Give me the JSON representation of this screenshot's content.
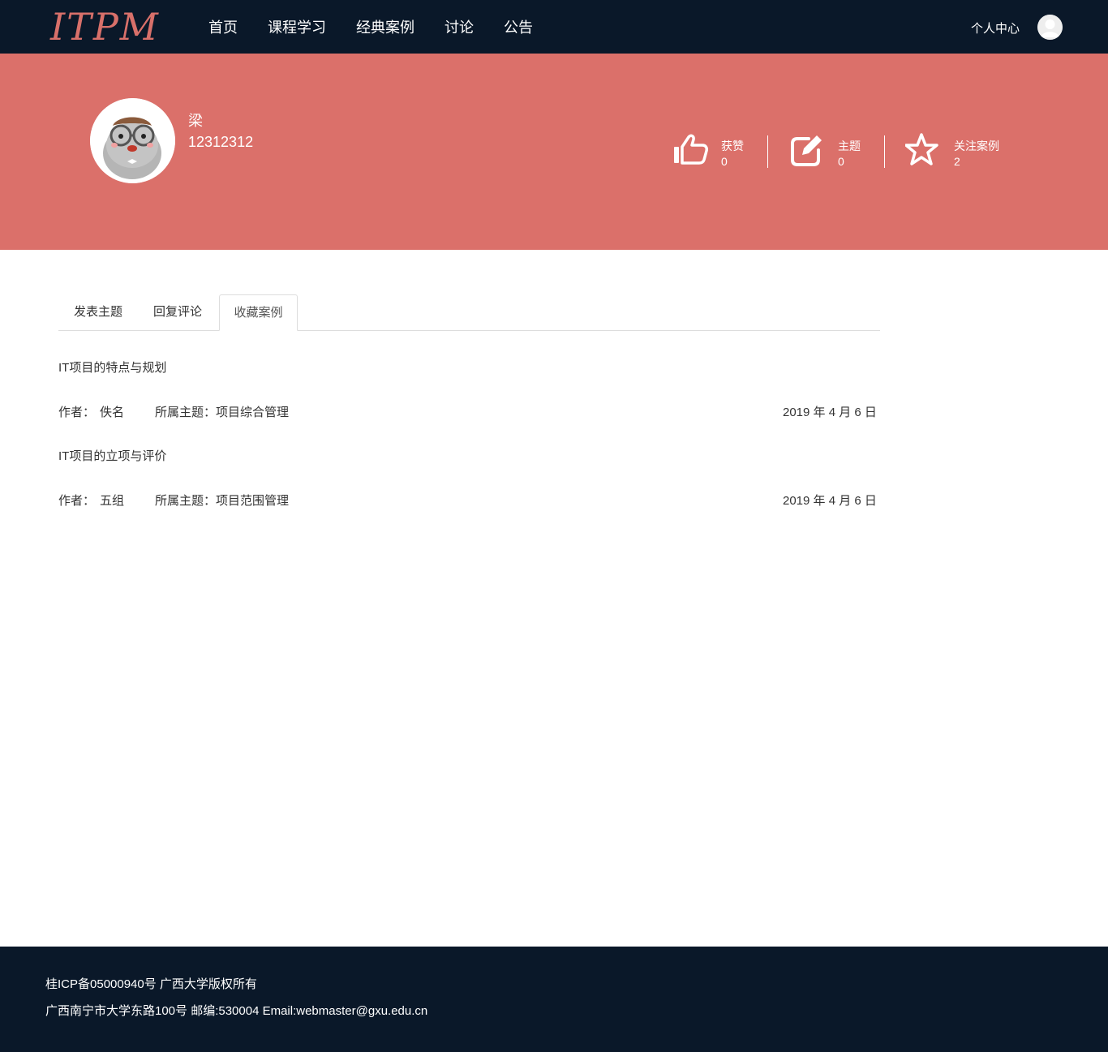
{
  "header": {
    "logo": "ITPM",
    "nav": [
      "首页",
      "课程学习",
      "经典案例",
      "讨论",
      "公告"
    ],
    "user_center": "个人中心"
  },
  "profile": {
    "name": "梁",
    "id": "12312312",
    "stats": [
      {
        "icon": "thumbs-up-icon",
        "label": "获赞",
        "value": "0"
      },
      {
        "icon": "edit-icon",
        "label": "主题",
        "value": "0"
      },
      {
        "icon": "star-icon",
        "label": "关注案例",
        "value": "2"
      }
    ],
    "banner_color": "#db706a"
  },
  "tabs": [
    {
      "label": "发表主题",
      "active": false
    },
    {
      "label": "回复评论",
      "active": false
    },
    {
      "label": "收藏案例",
      "active": true
    }
  ],
  "cases": [
    {
      "title": "IT项目的特点与规划",
      "author_label": "作者：",
      "author": "佚名",
      "topic": "所属主题：项目综合管理",
      "date": "2019 年 4 月 6 日"
    },
    {
      "title": "IT项目的立项与评价",
      "author_label": "作者：",
      "author": "五组",
      "topic": "所属主题：项目范围管理",
      "date": "2019 年 4 月 6 日"
    }
  ],
  "footer": {
    "line1": "桂ICP备05000940号 广西大学版权所有",
    "line2": "广西南宁市大学东路100号 邮编:530004 Email:webmaster@gxu.edu.cn"
  },
  "colors": {
    "nav_bg": "#0a1829",
    "accent": "#db706a"
  }
}
